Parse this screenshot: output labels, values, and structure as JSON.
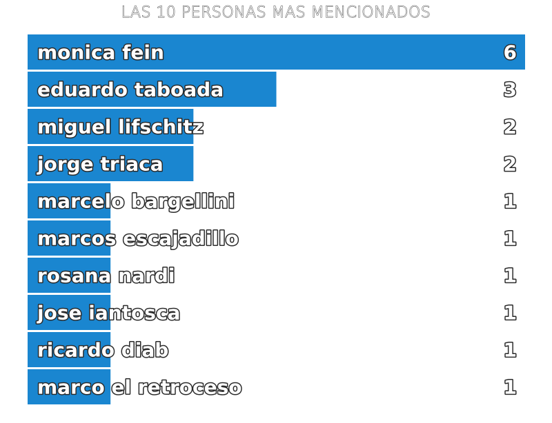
{
  "chart_data": {
    "type": "bar",
    "orientation": "horizontal",
    "title": "LAS 10 PERSONAS MAS MENCIONADOS",
    "categories": [
      "monica fein",
      "eduardo taboada",
      "miguel lifschitz",
      "jorge triaca",
      "marcelo bargellini",
      "marcos escajadillo",
      "rosana nardi",
      "jose iantosca",
      "ricardo diab",
      "marco el retroceso"
    ],
    "values": [
      6,
      3,
      2,
      2,
      1,
      1,
      1,
      1,
      1,
      1
    ],
    "xlim": [
      0,
      6
    ],
    "grid": false,
    "legend": "none",
    "colors": {
      "bar": "#1a86d0",
      "label_fill": "#ffffff",
      "label_outline": "#2a2a2a"
    }
  }
}
